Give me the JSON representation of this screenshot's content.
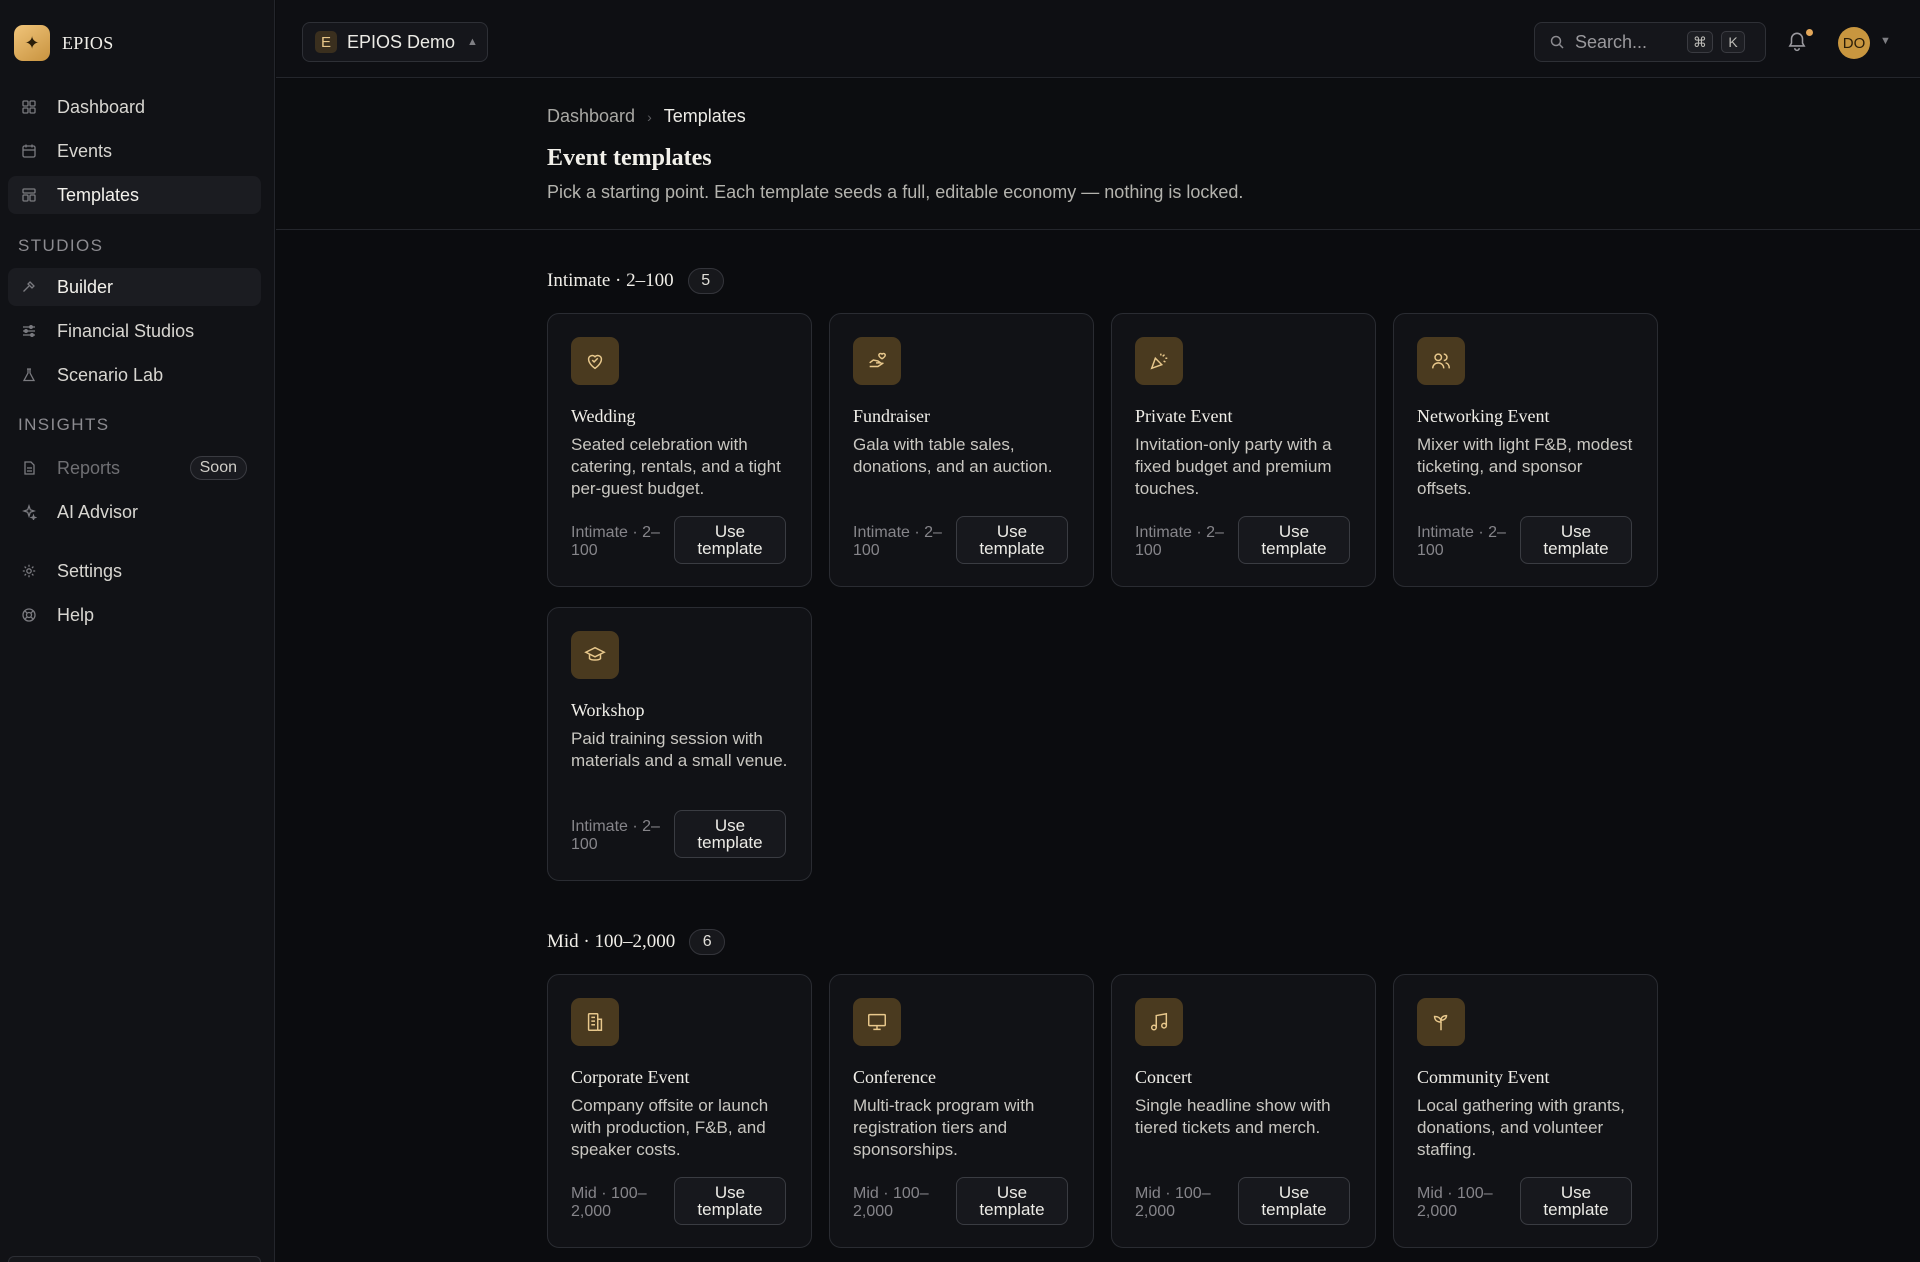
{
  "brand": {
    "logo_glyph": "✦",
    "name": "EPIOS"
  },
  "sidebar": {
    "items": [
      {
        "label": "Dashboard"
      },
      {
        "label": "Events"
      },
      {
        "label": "Templates"
      }
    ],
    "studios_label": "STUDIOS",
    "studios": [
      {
        "label": "Builder"
      },
      {
        "label": "Financial Studios"
      },
      {
        "label": "Scenario Lab"
      }
    ],
    "insights_label": "INSIGHTS",
    "insights": [
      {
        "label": "Reports",
        "badge": "Soon"
      },
      {
        "label": "AI Advisor"
      }
    ],
    "footer": [
      {
        "label": "Settings"
      },
      {
        "label": "Help"
      }
    ]
  },
  "topbar": {
    "workspace_initial": "E",
    "workspace_name": "EPIOS Demo",
    "search_placeholder": "Search...",
    "kbd_mod": "⌘",
    "kbd_key": "K",
    "user_initials": "DO"
  },
  "header": {
    "breadcrumb_root": "Dashboard",
    "breadcrumb_current": "Templates",
    "title": "Event templates",
    "subtitle": "Pick a starting point. Each template seeds a full, editable economy — nothing is locked."
  },
  "groups": [
    {
      "title": "Intimate · 2–100",
      "count": "5",
      "cards": [
        {
          "title": "Wedding",
          "desc": "Seated celebration with catering, rentals, and a tight per-guest budget.",
          "meta": "Intimate · 2–100",
          "button": "Use template",
          "icon": "heart-icon"
        },
        {
          "title": "Fundraiser",
          "desc": "Gala with table sales, donations, and an auction.",
          "meta": "Intimate · 2–100",
          "button": "Use template",
          "icon": "hand-heart-icon"
        },
        {
          "title": "Private Event",
          "desc": "Invitation-only party with a fixed budget and premium touches.",
          "meta": "Intimate · 2–100",
          "button": "Use template",
          "icon": "party-popper-icon"
        },
        {
          "title": "Networking Event",
          "desc": "Mixer with light F&B, modest ticketing, and sponsor offsets.",
          "meta": "Intimate · 2–100",
          "button": "Use template",
          "icon": "users-icon"
        },
        {
          "title": "Workshop",
          "desc": "Paid training session with materials and a small venue.",
          "meta": "Intimate · 2–100",
          "button": "Use template",
          "icon": "graduation-cap-icon"
        }
      ]
    },
    {
      "title": "Mid · 100–2,000",
      "count": "6",
      "cards": [
        {
          "title": "Corporate Event",
          "desc": "Company offsite or launch with production, F&B, and speaker costs.",
          "meta": "Mid · 100–2,000",
          "button": "Use template",
          "icon": "building-icon"
        },
        {
          "title": "Conference",
          "desc": "Multi-track program with registration tiers and sponsorships.",
          "meta": "Mid · 100–2,000",
          "button": "Use template",
          "icon": "presentation-icon"
        },
        {
          "title": "Concert",
          "desc": "Single headline show with tiered tickets and merch.",
          "meta": "Mid · 100–2,000",
          "button": "Use template",
          "icon": "music-icon"
        },
        {
          "title": "Community Event",
          "desc": "Local gathering with grants, donations, and volunteer staffing.",
          "meta": "Mid · 100–2,000",
          "button": "Use template",
          "icon": "sprout-icon"
        }
      ]
    }
  ],
  "colors": {
    "accent": "#c8963f",
    "icon_tile": "#4a3a1f",
    "background": "#0b0c0f"
  }
}
